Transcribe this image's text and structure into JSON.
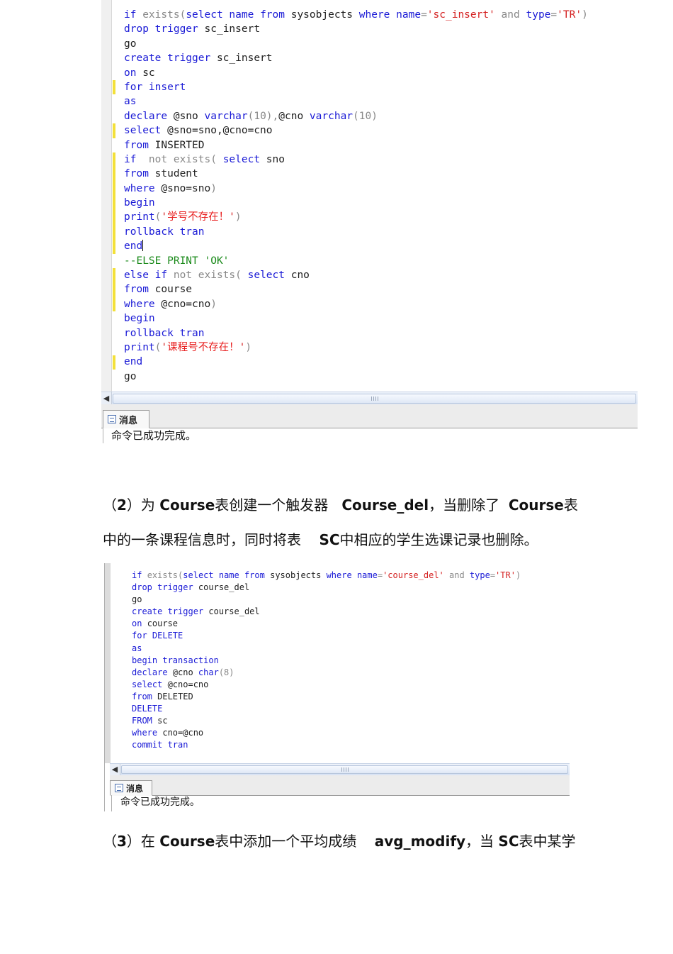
{
  "block1": {
    "code": [
      [
        [
          "kw",
          "if "
        ],
        [
          "op",
          "exists("
        ],
        [
          "kw",
          "select name from "
        ],
        [
          "",
          "sysobjects "
        ],
        [
          "kw",
          "where "
        ],
        [
          "kw",
          "name"
        ],
        [
          "op",
          "="
        ],
        [
          "str",
          "'sc_insert'"
        ],
        [
          "op",
          " and "
        ],
        [
          "kw",
          "type"
        ],
        [
          "op",
          "="
        ],
        [
          "str",
          "'TR'"
        ],
        [
          "op",
          ")"
        ]
      ],
      [
        [
          "kw",
          "drop trigger "
        ],
        [
          "",
          "sc_insert"
        ]
      ],
      [
        [
          "",
          "go"
        ]
      ],
      [
        [
          "kw",
          "create trigger "
        ],
        [
          "",
          "sc_insert"
        ]
      ],
      [
        [
          "kw",
          "on "
        ],
        [
          "",
          "sc"
        ]
      ],
      [
        [
          "kw",
          "for insert"
        ]
      ],
      [
        [
          "kw",
          "as"
        ]
      ],
      [
        [
          "kw",
          "declare "
        ],
        [
          "",
          "@sno "
        ],
        [
          "kw",
          "varchar"
        ],
        [
          "op",
          "(10),"
        ],
        [
          "",
          "@cno "
        ],
        [
          "kw",
          "varchar"
        ],
        [
          "op",
          "(10)"
        ]
      ],
      [
        [
          "kw",
          "select "
        ],
        [
          "",
          "@sno=sno,@cno=cno"
        ]
      ],
      [
        [
          "kw",
          "from "
        ],
        [
          "",
          "INSERTED"
        ]
      ],
      [
        [
          "kw",
          "if  "
        ],
        [
          "op",
          "not exists( "
        ],
        [
          "kw",
          "select "
        ],
        [
          "",
          "sno"
        ]
      ],
      [
        [
          "kw",
          "from "
        ],
        [
          "",
          "student"
        ]
      ],
      [
        [
          "kw",
          "where "
        ],
        [
          "",
          "@sno=sno"
        ],
        [
          "op",
          ")"
        ]
      ],
      [
        [
          "kw",
          "begin"
        ]
      ],
      [
        [
          "kw",
          "print"
        ],
        [
          "op",
          "("
        ],
        [
          "str",
          "'"
        ],
        [
          "cjk",
          "学号不存在！"
        ],
        [
          "str",
          "'"
        ],
        [
          "op",
          ")"
        ]
      ],
      [
        [
          "kw",
          "rollback tran"
        ]
      ],
      [
        [
          "kw",
          "end"
        ]
      ],
      [
        [
          "cm",
          "--ELSE PRINT 'OK'"
        ]
      ],
      [
        [
          "kw",
          "else if "
        ],
        [
          "op",
          "not exists( "
        ],
        [
          "kw",
          "select "
        ],
        [
          "",
          "cno"
        ]
      ],
      [
        [
          "kw",
          "from "
        ],
        [
          "",
          "course"
        ]
      ],
      [
        [
          "kw",
          "where "
        ],
        [
          "",
          "@cno=cno"
        ],
        [
          "op",
          ")"
        ]
      ],
      [
        [
          "kw",
          "begin"
        ]
      ],
      [
        [
          "kw",
          "rollback tran"
        ]
      ],
      [
        [
          "kw",
          "print"
        ],
        [
          "op",
          "("
        ],
        [
          "str",
          "'"
        ],
        [
          "cjk",
          "课程号不存在！"
        ],
        [
          "str",
          "'"
        ],
        [
          "op",
          ")"
        ]
      ],
      [
        [
          "kw",
          "end"
        ]
      ],
      [
        [
          "",
          "go"
        ]
      ]
    ],
    "tab_label": "消息",
    "message": "命令已成功完成。"
  },
  "para2": {
    "line1": [
      [
        "",
        "（"
      ],
      [
        "b",
        "2"
      ],
      [
        "",
        "）为 "
      ],
      [
        "b",
        "Course"
      ],
      [
        "",
        "表创建一个触发器   "
      ],
      [
        "b",
        "Course_del"
      ],
      [
        "",
        "，当删除了  "
      ],
      [
        "b",
        "Course"
      ],
      [
        "",
        "表"
      ]
    ],
    "line2": [
      [
        "",
        "中的一条课程信息时，同时将表    "
      ],
      [
        "b",
        "SC"
      ],
      [
        "",
        "中相应的学生选课记录也删除。"
      ]
    ]
  },
  "block2": {
    "code": [
      [
        [
          "kw",
          "if "
        ],
        [
          "op",
          "exists("
        ],
        [
          "kw",
          "select name from "
        ],
        [
          "",
          "sysobjects "
        ],
        [
          "kw",
          "where "
        ],
        [
          "kw",
          "name"
        ],
        [
          "op",
          "="
        ],
        [
          "str",
          "'course_del'"
        ],
        [
          "op",
          " and "
        ],
        [
          "kw",
          "type"
        ],
        [
          "op",
          "="
        ],
        [
          "str",
          "'TR'"
        ],
        [
          "op",
          ")"
        ]
      ],
      [
        [
          "kw",
          "drop trigger "
        ],
        [
          "",
          "course_del"
        ]
      ],
      [
        [
          "",
          "go"
        ]
      ],
      [
        [
          "kw",
          "create trigger "
        ],
        [
          "",
          "course_del"
        ]
      ],
      [
        [
          "kw",
          "on "
        ],
        [
          "",
          "course"
        ]
      ],
      [
        [
          "kw",
          "for DELETE"
        ]
      ],
      [
        [
          "kw",
          "as"
        ]
      ],
      [
        [
          "kw",
          "begin transaction"
        ]
      ],
      [
        [
          "kw",
          "declare "
        ],
        [
          "",
          "@cno "
        ],
        [
          "kw",
          "char"
        ],
        [
          "op",
          "(8)"
        ]
      ],
      [
        [
          "kw",
          "select "
        ],
        [
          "",
          "@cno=cno"
        ]
      ],
      [
        [
          "kw",
          "from "
        ],
        [
          "",
          "DELETED"
        ]
      ],
      [
        [
          "kw",
          "DELETE"
        ]
      ],
      [
        [
          "kw",
          "FROM "
        ],
        [
          "",
          "sc"
        ]
      ],
      [
        [
          "kw",
          "where "
        ],
        [
          "",
          "cno=@cno"
        ]
      ],
      [
        [
          "kw",
          "commit tran"
        ]
      ]
    ],
    "tab_label": "消息",
    "message": "命令已成功完成。"
  },
  "para3": {
    "line1": [
      [
        "",
        "（"
      ],
      [
        "b",
        "3"
      ],
      [
        "",
        "）在 "
      ],
      [
        "b",
        "Course"
      ],
      [
        "",
        "表中添加一个平均成绩    "
      ],
      [
        "b",
        "avg_modify"
      ],
      [
        "",
        "，当 "
      ],
      [
        "b",
        "SC"
      ],
      [
        "",
        "表中某学"
      ]
    ]
  }
}
